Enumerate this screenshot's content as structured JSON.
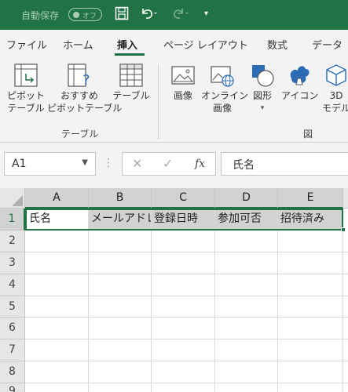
{
  "titlebar": {
    "autosave_label": "自動保存",
    "autosave_state": "オフ"
  },
  "ribbon_tabs": [
    "ファイル",
    "ホーム",
    "挿入",
    "ページ レイアウト",
    "数式",
    "データ"
  ],
  "active_tab": "挿入",
  "ribbon": {
    "pivot_table": [
      "ピボット",
      "テーブル"
    ],
    "recommended_pivot": [
      "おすすめ",
      "ピボットテーブル"
    ],
    "table": "テーブル",
    "group_tables": "テーブル",
    "pictures": "画像",
    "online_pictures": [
      "オンライン",
      "画像"
    ],
    "shapes": "図形",
    "icons": "アイコン",
    "models_3d": [
      "3D",
      "モデル"
    ],
    "group_illustrations": "図"
  },
  "formula_bar": {
    "name_box": "A1",
    "fx_label": "fx",
    "formula": "氏名"
  },
  "grid": {
    "columns": [
      "A",
      "B",
      "C",
      "D",
      "E"
    ],
    "rows": [
      "1",
      "2",
      "3",
      "4",
      "5",
      "6",
      "7",
      "8",
      "9"
    ],
    "row1": [
      "氏名",
      "メールアドレス",
      "登録日時",
      "参加可否",
      "招待済み"
    ]
  },
  "colors": {
    "excel_green": "#217346",
    "ribbon_bg": "#f3f3f3",
    "header_bg": "#e6e6e6",
    "selected_bg": "#d2d2d2"
  }
}
